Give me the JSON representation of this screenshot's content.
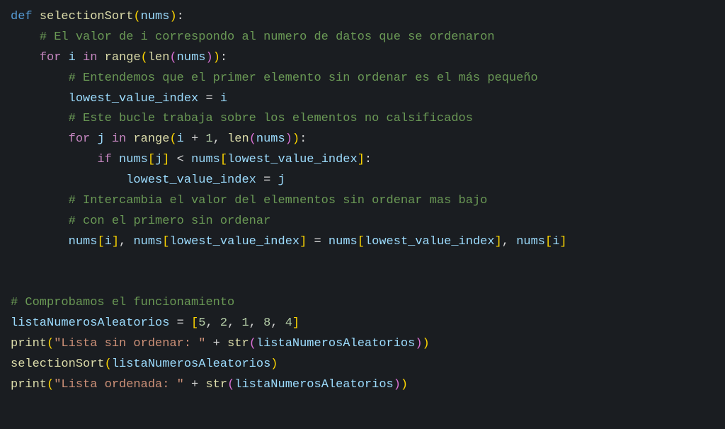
{
  "code": {
    "line1": {
      "def": "def",
      "name": "selectionSort",
      "param": "nums"
    },
    "line2_comment": "# El valor de i correspondo al numero de datos que se ordenaron",
    "line3": {
      "for": "for",
      "var_i": "i",
      "in": "in",
      "range": "range",
      "len": "len",
      "nums": "nums"
    },
    "line4_comment": "# Entendemos que el primer elemento sin ordenar es el más pequeño",
    "line5": {
      "lvi": "lowest_value_index",
      "eq": " = ",
      "i": "i"
    },
    "line6_comment": "# Este bucle trabaja sobre los elementos no calsificados",
    "line7": {
      "for": "for",
      "var_j": "j",
      "in": "in",
      "range": "range",
      "i": "i",
      "plus": " + ",
      "one": "1",
      "comma": ", ",
      "len": "len",
      "nums": "nums"
    },
    "line8": {
      "if": "if",
      "nums1": "nums",
      "j": "j",
      "lt": " < ",
      "nums2": "nums",
      "lvi": "lowest_value_index"
    },
    "line9": {
      "lvi": "lowest_value_index",
      "eq": " = ",
      "j": "j"
    },
    "line10_comment": "# Intercambia el valor del elemnentos sin ordenar mas bajo",
    "line11_comment": "# con el primero sin ordenar",
    "line12": {
      "nums1": "nums",
      "i1": "i",
      "nums2": "nums",
      "lvi1": "lowest_value_index",
      "eq": " = ",
      "nums3": "nums",
      "lvi2": "lowest_value_index",
      "nums4": "nums",
      "i2": "i"
    },
    "line15_comment": "# Comprobamos el funcionamiento",
    "line16": {
      "var": "listaNumerosAleatorios",
      "eq": " = ",
      "n1": "5",
      "n2": "2",
      "n3": "1",
      "n4": "8",
      "n5": "4"
    },
    "line17": {
      "print": "print",
      "str_lit": "\"Lista sin ordenar: \"",
      "plus": " + ",
      "str_fn": "str",
      "var": "listaNumerosAleatorios"
    },
    "line18": {
      "fn": "selectionSort",
      "var": "listaNumerosAleatorios"
    },
    "line19": {
      "print": "print",
      "str_lit": "\"Lista ordenada: \"",
      "plus": " + ",
      "str_fn": "str",
      "var": "listaNumerosAleatorios"
    }
  }
}
